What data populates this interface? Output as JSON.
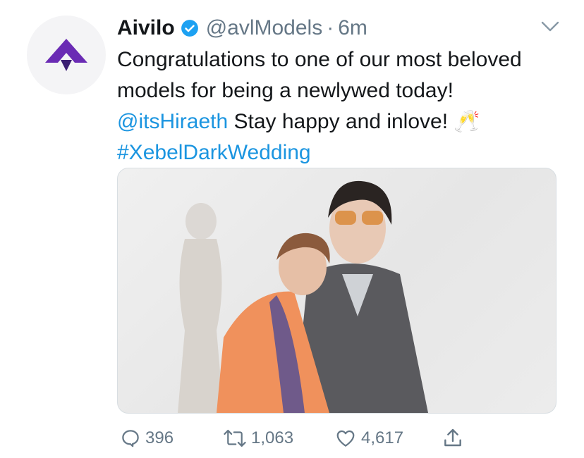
{
  "tweet": {
    "display_name": "Aivilo",
    "handle": "@avlModels",
    "separator": "·",
    "time": "6m",
    "text_part1": "Congratulations to one of our most beloved models for being a newlywed today! ",
    "mention": "@itsHiraeth",
    "text_part2": " Stay happy and inlove! 🥂 ",
    "hashtag": "#XebelDarkWedding"
  },
  "actions": {
    "replies": "396",
    "retweets": "1,063",
    "likes": "4,617"
  },
  "icons": {
    "avatar": "aivilo-logo",
    "verified": "verified-badge-icon",
    "menu": "chevron-down-icon",
    "reply": "reply-icon",
    "retweet": "retweet-icon",
    "like": "heart-icon",
    "share": "share-icon"
  },
  "colors": {
    "link": "#1b95e0",
    "muted": "#657786",
    "logo": "#6a2bb4"
  }
}
